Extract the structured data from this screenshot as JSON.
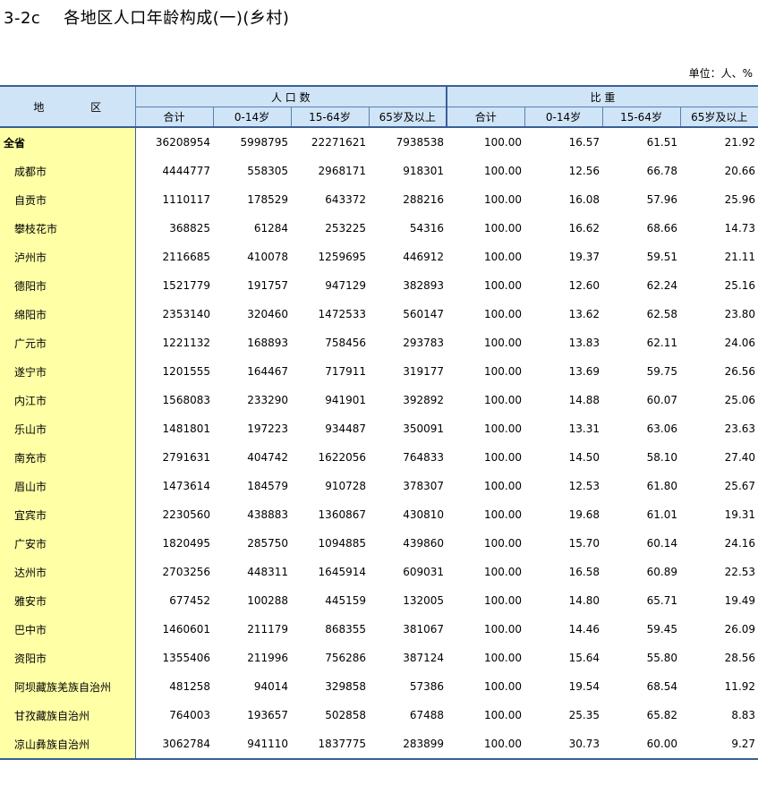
{
  "title": {
    "code": "3-2c",
    "text": "各地区人口年龄构成(一)(乡村)"
  },
  "unit": "单位：人、%",
  "header": {
    "region": "地 区",
    "group_population": "人 口 数",
    "group_ratio": "比 重",
    "columns": [
      "合计",
      "0-14岁",
      "15-64岁",
      "65岁及以上",
      "合计",
      "0-14岁",
      "15-64岁",
      "65岁及以上"
    ]
  },
  "rows": [
    {
      "name": "全省",
      "v": [
        "36208954",
        "5998795",
        "22271621",
        "7938538",
        "100.00",
        "16.57",
        "61.51",
        "21.92"
      ]
    },
    {
      "name": "成都市",
      "v": [
        "4444777",
        "558305",
        "2968171",
        "918301",
        "100.00",
        "12.56",
        "66.78",
        "20.66"
      ]
    },
    {
      "name": "自贡市",
      "v": [
        "1110117",
        "178529",
        "643372",
        "288216",
        "100.00",
        "16.08",
        "57.96",
        "25.96"
      ]
    },
    {
      "name": "攀枝花市",
      "v": [
        "368825",
        "61284",
        "253225",
        "54316",
        "100.00",
        "16.62",
        "68.66",
        "14.73"
      ]
    },
    {
      "name": "泸州市",
      "v": [
        "2116685",
        "410078",
        "1259695",
        "446912",
        "100.00",
        "19.37",
        "59.51",
        "21.11"
      ]
    },
    {
      "name": "德阳市",
      "v": [
        "1521779",
        "191757",
        "947129",
        "382893",
        "100.00",
        "12.60",
        "62.24",
        "25.16"
      ]
    },
    {
      "name": "绵阳市",
      "v": [
        "2353140",
        "320460",
        "1472533",
        "560147",
        "100.00",
        "13.62",
        "62.58",
        "23.80"
      ]
    },
    {
      "name": "广元市",
      "v": [
        "1221132",
        "168893",
        "758456",
        "293783",
        "100.00",
        "13.83",
        "62.11",
        "24.06"
      ]
    },
    {
      "name": "遂宁市",
      "v": [
        "1201555",
        "164467",
        "717911",
        "319177",
        "100.00",
        "13.69",
        "59.75",
        "26.56"
      ]
    },
    {
      "name": "内江市",
      "v": [
        "1568083",
        "233290",
        "941901",
        "392892",
        "100.00",
        "14.88",
        "60.07",
        "25.06"
      ]
    },
    {
      "name": "乐山市",
      "v": [
        "1481801",
        "197223",
        "934487",
        "350091",
        "100.00",
        "13.31",
        "63.06",
        "23.63"
      ]
    },
    {
      "name": "南充市",
      "v": [
        "2791631",
        "404742",
        "1622056",
        "764833",
        "100.00",
        "14.50",
        "58.10",
        "27.40"
      ]
    },
    {
      "name": "眉山市",
      "v": [
        "1473614",
        "184579",
        "910728",
        "378307",
        "100.00",
        "12.53",
        "61.80",
        "25.67"
      ]
    },
    {
      "name": "宜宾市",
      "v": [
        "2230560",
        "438883",
        "1360867",
        "430810",
        "100.00",
        "19.68",
        "61.01",
        "19.31"
      ]
    },
    {
      "name": "广安市",
      "v": [
        "1820495",
        "285750",
        "1094885",
        "439860",
        "100.00",
        "15.70",
        "60.14",
        "24.16"
      ]
    },
    {
      "name": "达州市",
      "v": [
        "2703256",
        "448311",
        "1645914",
        "609031",
        "100.00",
        "16.58",
        "60.89",
        "22.53"
      ]
    },
    {
      "name": "雅安市",
      "v": [
        "677452",
        "100288",
        "445159",
        "132005",
        "100.00",
        "14.80",
        "65.71",
        "19.49"
      ]
    },
    {
      "name": "巴中市",
      "v": [
        "1460601",
        "211179",
        "868355",
        "381067",
        "100.00",
        "14.46",
        "59.45",
        "26.09"
      ]
    },
    {
      "name": "资阳市",
      "v": [
        "1355406",
        "211996",
        "756286",
        "387124",
        "100.00",
        "15.64",
        "55.80",
        "28.56"
      ]
    },
    {
      "name": "阿坝藏族羌族自治州",
      "v": [
        "481258",
        "94014",
        "329858",
        "57386",
        "100.00",
        "19.54",
        "68.54",
        "11.92"
      ]
    },
    {
      "name": "甘孜藏族自治州",
      "v": [
        "764003",
        "193657",
        "502858",
        "67488",
        "100.00",
        "25.35",
        "65.82",
        "8.83"
      ]
    },
    {
      "name": "凉山彝族自治州",
      "v": [
        "3062784",
        "941110",
        "1837775",
        "283899",
        "100.00",
        "30.73",
        "60.00",
        "9.27"
      ]
    }
  ]
}
